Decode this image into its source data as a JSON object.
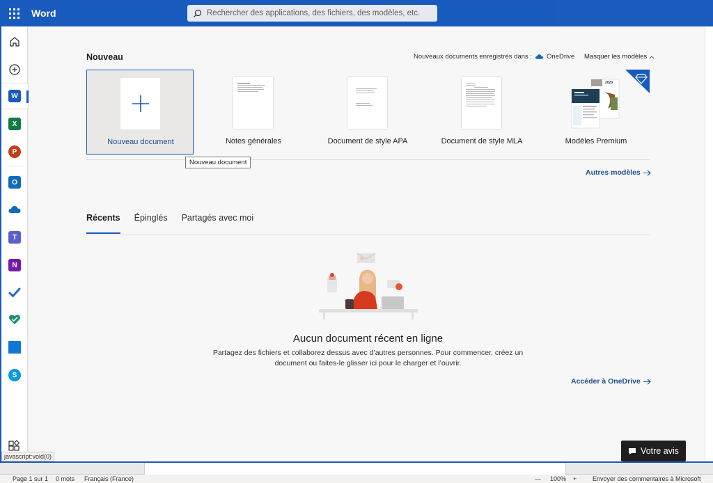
{
  "header": {
    "app_title": "Word",
    "search_placeholder": "Rechercher des applications, des fichiers, des modèles, etc."
  },
  "rail": {
    "items": [
      "home-icon",
      "create-icon",
      "word-icon",
      "excel-icon",
      "powerpoint-icon",
      "outlook-icon",
      "onedrive-icon",
      "teams-icon",
      "onenote-icon",
      "todo-icon",
      "family-safety-icon",
      "sway-icon",
      "skype-icon",
      "all-apps-icon"
    ]
  },
  "new_section": {
    "heading": "Nouveau",
    "save_info": "Nouveaux documents enregistrés dans :",
    "save_location": "OneDrive",
    "hide_templates": "Masquer les modèles",
    "templates": [
      {
        "label": "Nouveau document"
      },
      {
        "label": "Notes générales"
      },
      {
        "label": "Document de style APA"
      },
      {
        "label": "Document de style MLA"
      },
      {
        "label": "Modèles Premium"
      }
    ],
    "premium_year": "2020",
    "tooltip": "Nouveau document",
    "more_templates": "Autres modèles"
  },
  "tabs": [
    {
      "label": "Récents",
      "active": true
    },
    {
      "label": "Épinglés",
      "active": false
    },
    {
      "label": "Partagés avec moi",
      "active": false
    }
  ],
  "empty_state": {
    "title": "Aucun document récent en ligne",
    "description": "Partagez des fichiers et collaborez dessus avec d’autres personnes. Pour commencer, créez un document ou faites-le glisser ici pour le charger et l’ouvrir.",
    "go_onedrive": "Accéder à OneDrive"
  },
  "feedback_button": "Votre avis",
  "js_status": "javascript:void(0)",
  "statusbar": {
    "page": "Page 1 sur 1",
    "words": "0 mots",
    "language": "Français (France)",
    "zoom": "100%",
    "feedback": "Envoyer des commentaires à Microsoft"
  },
  "colors": {
    "brand": "#185abd",
    "link": "#1f4e8c",
    "background": "#f7f7f7"
  }
}
